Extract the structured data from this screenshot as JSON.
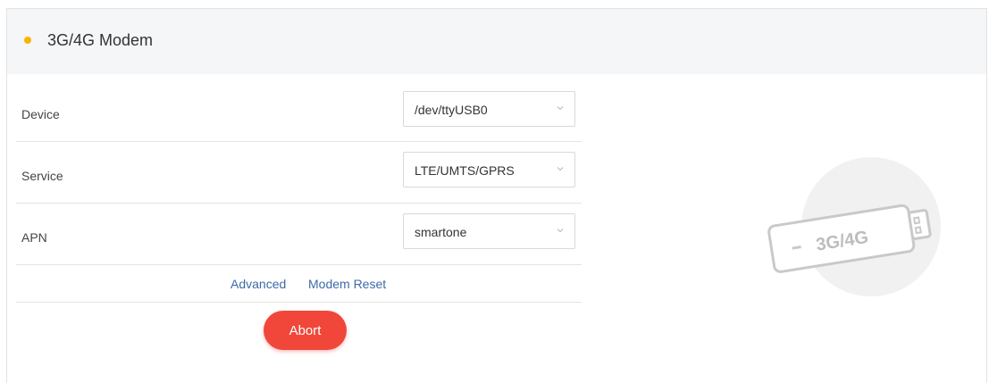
{
  "panel": {
    "title": "3G/4G Modem",
    "accent_color": "#f7b500"
  },
  "form": {
    "fields": [
      {
        "label": "Device",
        "value": "/dev/ttyUSB0"
      },
      {
        "label": "Service",
        "value": "LTE/UMTS/GPRS"
      },
      {
        "label": "APN",
        "value": "smartone"
      }
    ],
    "links": {
      "advanced": "Advanced",
      "modem_reset": "Modem Reset"
    },
    "abort_label": "Abort",
    "abort_color": "#f0473a"
  },
  "illustration": {
    "icon": "usb-modem-icon",
    "text": "3G/4G"
  }
}
